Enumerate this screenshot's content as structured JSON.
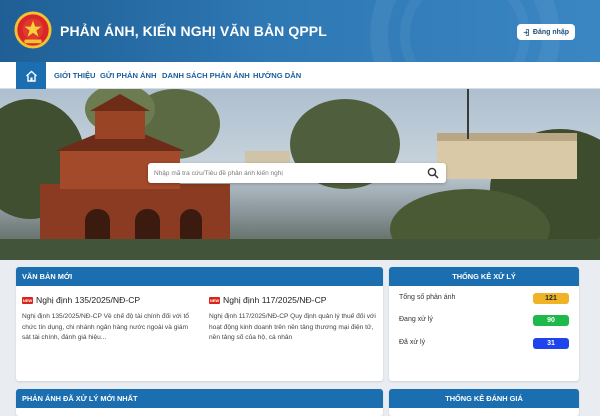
{
  "header": {
    "site_title": "PHẢN ÁNH, KIẾN NGHỊ VĂN BẢN QPPL",
    "login_label": "Đăng nhập"
  },
  "nav": {
    "items": [
      {
        "label": "GIỚI THIỆU"
      },
      {
        "label": "GỬI PHẢN ÁNH"
      },
      {
        "label": "DANH SÁCH PHẢN ÁNH"
      },
      {
        "label": "HƯỚNG DẪN"
      }
    ]
  },
  "search": {
    "placeholder": "Nhập mã tra cứu/Tiêu đề phản ánh kiến nghị"
  },
  "new_docs": {
    "title": "VĂN BẢN MỚI",
    "items": [
      {
        "title": "Nghị định 135/2025/NĐ-CP",
        "description": "Nghị định 135/2025/NĐ-CP Về chế độ tài chính đối với tổ chức tín dụng, chi nhánh ngân hàng nước ngoài và giám sát tài chính, đánh giá hiệu..."
      },
      {
        "title": "Nghị định 117/2025/NĐ-CP",
        "description": "Nghị định 117/2025/NĐ-CP Quy định quản lý thuế đối với hoạt động kinh doanh trên nền tảng thương mại điện tử, nền tảng số của hộ, cá nhân"
      }
    ]
  },
  "stats": {
    "title": "THỐNG KÊ XỬ LÝ",
    "rows": [
      {
        "label": "Tổng số phản ánh",
        "value": "121",
        "color": "#f0b326",
        "text_color": "#222222"
      },
      {
        "label": "Đang xử lý",
        "value": "90",
        "color": "#1fb84a",
        "text_color": "#ffffff"
      },
      {
        "label": "Đã xử lý",
        "value": "31",
        "color": "#1f44ee",
        "text_color": "#ffffff"
      }
    ]
  },
  "latest_processed": {
    "title": "PHẢN ÁNH ĐÃ XỬ LÝ MỚI NHẤT"
  },
  "rating_stats": {
    "title": "THỐNG KÊ ĐÁNH GIÁ"
  },
  "colors": {
    "brand": "#1b6fb0",
    "header": "#2e78b4",
    "badge_red": "#d9251c"
  },
  "icons": {
    "emblem": "national-emblem-icon",
    "login": "login-icon",
    "home": "home-icon",
    "search": "search-icon",
    "doc": "new-document-icon"
  }
}
